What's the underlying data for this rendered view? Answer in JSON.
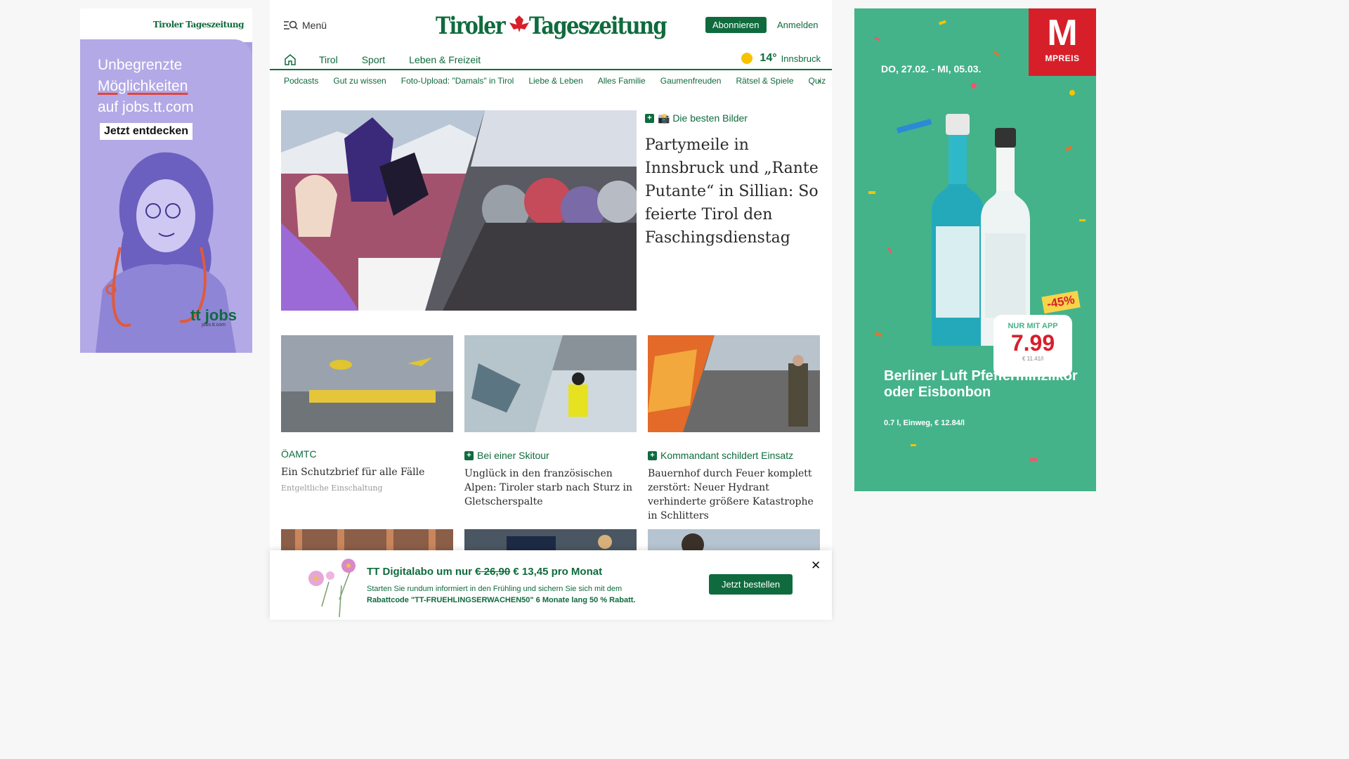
{
  "left_ad": {
    "brand": "Tiroler Tageszeitung",
    "line1": "Unbegrenzte",
    "line2": "Möglichkeiten",
    "line3": "auf jobs.tt.com",
    "cta": "Jetzt entdecken",
    "jobs_logo": "tt jobs",
    "jobs_url": "jobs.tt.com"
  },
  "header": {
    "menu_label": "Menü",
    "logo_text": "Tiroler Tageszeitung",
    "subscribe_label": "Abonnieren",
    "login_label": "Anmelden"
  },
  "nav": {
    "home_icon": "home-icon",
    "items": [
      "Tirol",
      "Sport",
      "Leben & Freizeit"
    ],
    "weather": {
      "temp": "14°",
      "city": "Innsbruck"
    }
  },
  "subnav": {
    "items": [
      "Podcasts",
      "Gut zu wissen",
      "Foto-Upload: \"Damals\" in Tirol",
      "Liebe & Leben",
      "Alles Familie",
      "Gaumenfreuden",
      "Rätsel & Spiele",
      "Quiz"
    ]
  },
  "hero": {
    "kicker": "📸 Die besten Bilder",
    "title": "Partymeile in Innsbruck und „Rante Putante“ in Sillian: So feierte Tirol den Faschingsdienstag"
  },
  "cards": [
    {
      "kicker": "ÖAMTC",
      "title": "Ein Schutzbrief für alle Fälle",
      "sponsored": "Entgeltliche Einschaltung"
    },
    {
      "kicker": "Bei einer Skitour",
      "title": "Unglück in den französischen Alpen: Tiroler starb nach Sturz in Gletscherspalte"
    },
    {
      "kicker": "Kommandant schildert Einsatz",
      "title": "Bauernhof durch Feuer komplett zerstört: Neuer Hydrant verhinderte größere Katastrophe in Schlitters"
    }
  ],
  "promo": {
    "title_prefix": "TT Digitalabo um nur",
    "old_price": "€ 26,90",
    "new_price": "€ 13,45 pro Monat",
    "text1": "Starten Sie rundum informiert in den Frühling und sichern Sie sich mit dem",
    "text2": "Rabattcode \"TT-FRUEHLINGSERWACHEN50\" 6 Monate lang 50 % Rabatt.",
    "button": "Jetzt bestellen"
  },
  "right_ad": {
    "brand_letter": "M",
    "brand": "MPREIS",
    "date": "DO, 27.02. - MI, 05.03.",
    "discount": "-45%",
    "app_label": "NUR MIT APP",
    "price": "7.99",
    "unit_price": "€ 11.41/l",
    "product": "Berliner Luft Pfefferminzlikör oder Eisbonbon",
    "product_sub": "0.7 l, Einweg, € 12.84/l"
  },
  "colors": {
    "brand_green": "#0f6b3d",
    "accent_red": "#d71f2a",
    "ad_lilac": "#b3a9e6",
    "ad_green": "#44b38a"
  }
}
